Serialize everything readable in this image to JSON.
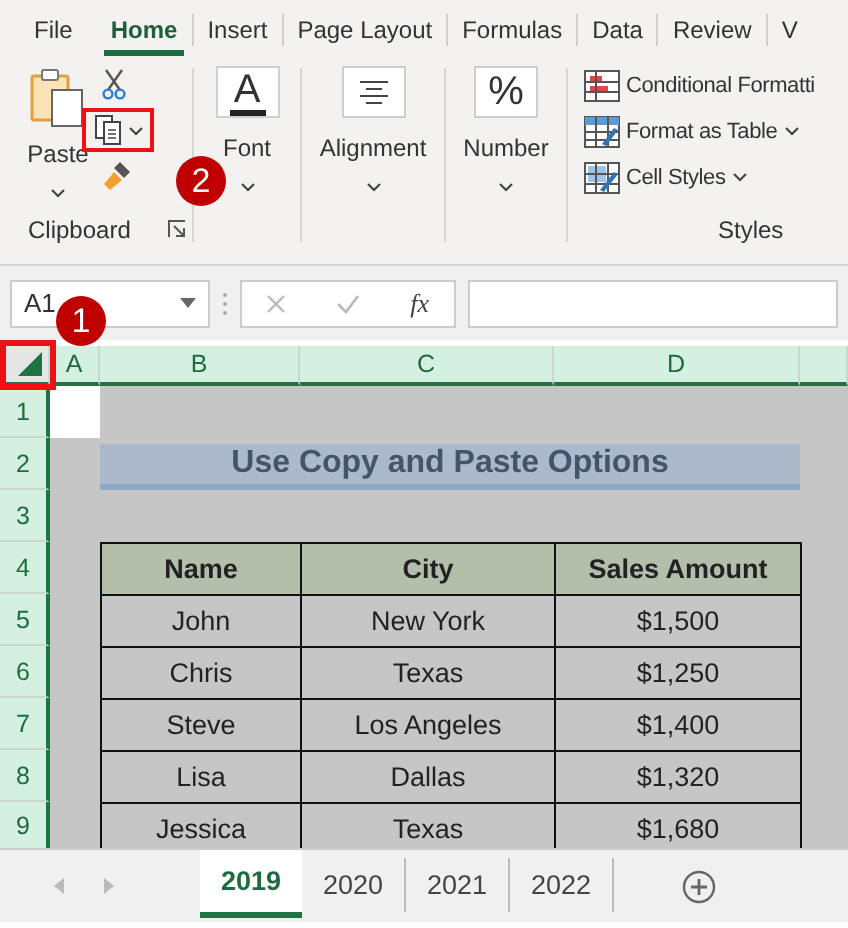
{
  "menu_tabs": [
    {
      "label": "File",
      "selected": false
    },
    {
      "label": "Home",
      "selected": true
    },
    {
      "label": "Insert",
      "selected": false
    },
    {
      "label": "Page Layout",
      "selected": false
    },
    {
      "label": "Formulas",
      "selected": false
    },
    {
      "label": "Data",
      "selected": false
    },
    {
      "label": "Review",
      "selected": false
    },
    {
      "label": "V",
      "selected": false
    }
  ],
  "ribbon": {
    "clipboard": {
      "paste_label": "Paste",
      "group_label": "Clipboard"
    },
    "font": {
      "glyph": "A",
      "label": "Font"
    },
    "alignment": {
      "label": "Alignment"
    },
    "number": {
      "glyph": "%",
      "label": "Number"
    },
    "styles": {
      "items": [
        {
          "kind": "conditional",
          "label": "Conditional Formatti",
          "dropdown": false
        },
        {
          "kind": "table",
          "label": "Format as Table",
          "dropdown": true
        },
        {
          "kind": "cellstyles",
          "label": "Cell Styles",
          "dropdown": true
        }
      ],
      "group_label": "Styles"
    }
  },
  "name_box": "A1",
  "function_label": "fx",
  "column_headers": [
    "A",
    "B",
    "C",
    "D"
  ],
  "row_headers": [
    "1",
    "2",
    "3",
    "4",
    "5",
    "6",
    "7",
    "8",
    "9"
  ],
  "all_selected": true,
  "sheet": {
    "title": "Use Copy and Paste Options",
    "table": {
      "columns": [
        "Name",
        "City",
        "Sales Amount"
      ],
      "rows": [
        [
          "John",
          "New York",
          "$1,500"
        ],
        [
          "Chris",
          "Texas",
          "$1,250"
        ],
        [
          "Steve",
          "Los Angeles",
          "$1,400"
        ],
        [
          "Lisa",
          "Dallas",
          "$1,320"
        ],
        [
          "Jessica",
          "Texas",
          "$1,680"
        ]
      ]
    }
  },
  "sheet_tabs": [
    {
      "label": "2019",
      "selected": true
    },
    {
      "label": "2020",
      "selected": false
    },
    {
      "label": "2021",
      "selected": false
    },
    {
      "label": "2022",
      "selected": false
    }
  ],
  "annotations": [
    {
      "label": "1"
    },
    {
      "label": "2"
    }
  ]
}
